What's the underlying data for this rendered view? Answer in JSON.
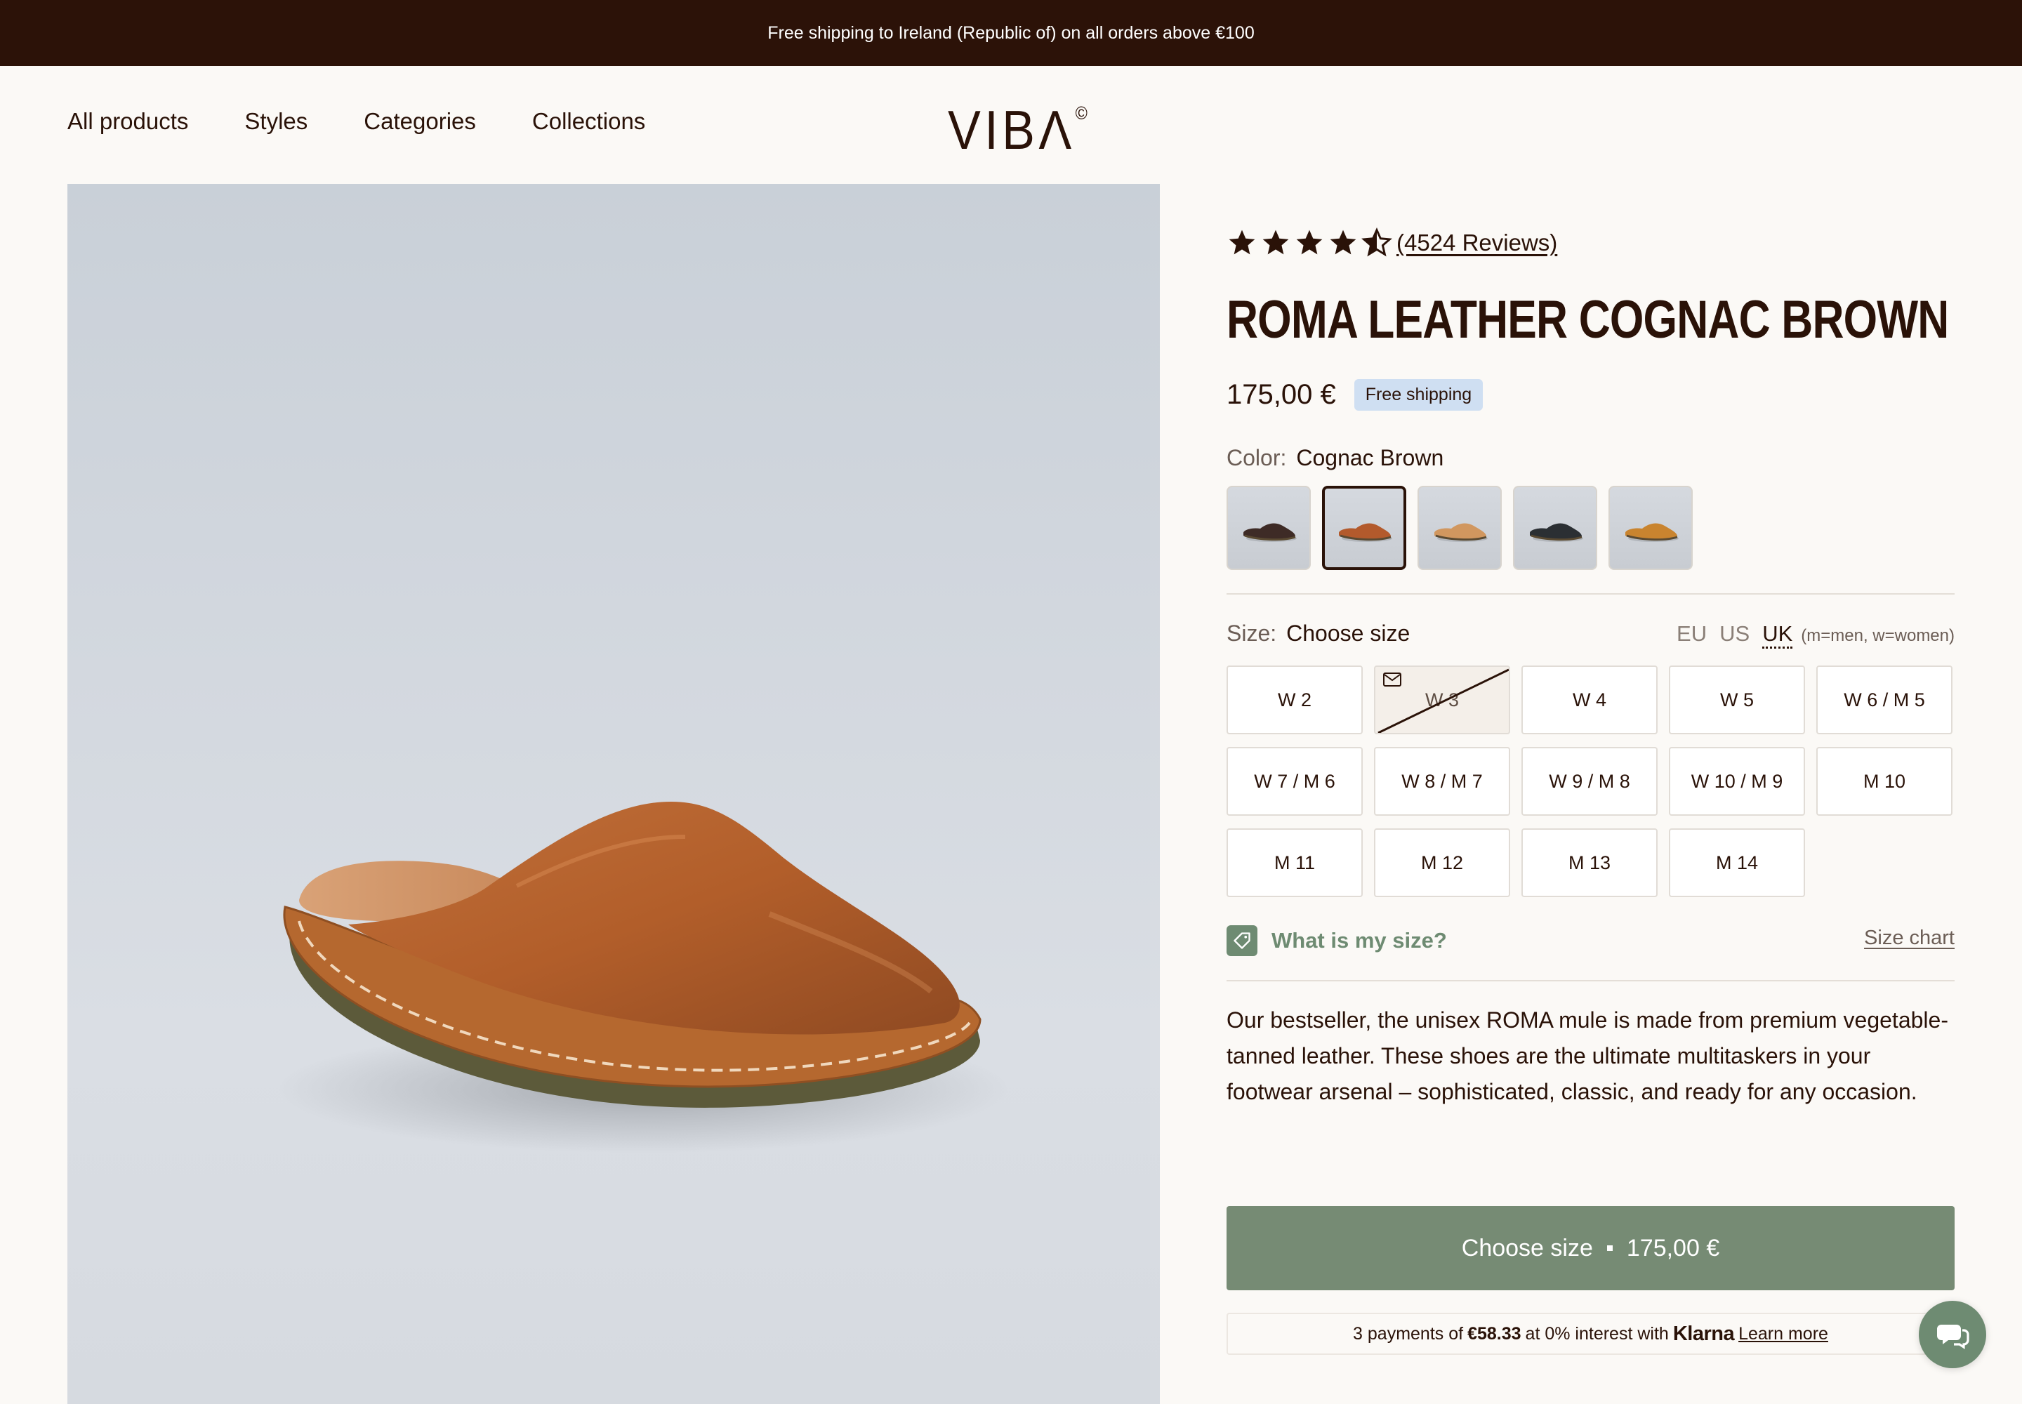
{
  "announcement": "Free shipping to Ireland (Republic of) on all orders above €100",
  "nav": [
    "All products",
    "Styles",
    "Categories",
    "Collections"
  ],
  "logo": {
    "text": "VIBΛ",
    "mark": "©"
  },
  "product": {
    "rating": 4.5,
    "reviews": "(4524 Reviews)",
    "title": "ROMA LEATHER COGNAC BROWN",
    "price": "175,00 €",
    "badge": "Free shipping",
    "color_label": "Color:",
    "color_value": "Cognac Brown",
    "swatch_colors": [
      "#3e2b26",
      "#b35a2c",
      "#d1975f",
      "#2b2f33",
      "#c9842f"
    ],
    "selected_swatch": 1,
    "size_label": "Size:",
    "size_value": "Choose size",
    "units": [
      "EU",
      "US",
      "UK"
    ],
    "units_active": "UK",
    "units_note": "(m=men, w=women)",
    "sizes": [
      "W 2",
      "W 3",
      "W 4",
      "W 5",
      "W 6 / M 5",
      "W 7 / M 6",
      "W 8 / M 7",
      "W 9 / M 8",
      "W 10 / M 9",
      "M 10",
      "M 11",
      "M 12",
      "M 13",
      "M 14"
    ],
    "sold_out_sizes": [
      "W 3"
    ],
    "what_size": "What is my size?",
    "size_chart": "Size chart",
    "description": "Our bestseller, the unisex ROMA mule is made from premium vegetable-tanned leather. These shoes are the ultimate multitaskers in your footwear arsenal – sophisticated, classic, and ready for any occasion.",
    "cta_label": "Choose size",
    "cta_price": "175,00 €",
    "klarna": {
      "prefix": "3 payments of",
      "amount": "€58.33",
      "middle": "at 0% interest with",
      "brand": "Klarna",
      "link": "Learn more"
    }
  },
  "colors": {
    "brand_dark": "#2c1208",
    "accent_green": "#768b74",
    "badge_blue": "#cfdff2"
  }
}
